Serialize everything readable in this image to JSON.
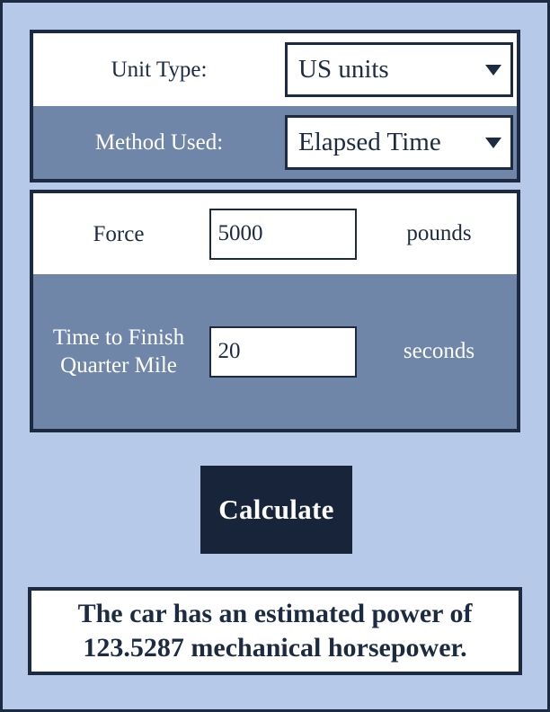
{
  "theme": {
    "page_background": "#b7c9e8",
    "border_dark": "#1c2b42",
    "row_shaded": "#6f86a8",
    "row_light": "#ffffff",
    "button_background": "#17243a",
    "button_text": "#ffffff"
  },
  "form": {
    "settings_rows": [
      {
        "label": "Unit Type:",
        "control": "select",
        "value": "US units",
        "shaded": false,
        "caret": "chevron-down-icon"
      },
      {
        "label": "Method Used:",
        "control": "select",
        "value": "Elapsed Time",
        "shaded": true,
        "caret": "chevron-down-icon"
      }
    ],
    "input_rows": [
      {
        "label": "Force",
        "control": "text",
        "value": "5000",
        "unit": "pounds",
        "shaded": false
      },
      {
        "label": "Time to Finish Quarter Mile",
        "control": "text",
        "value": "20",
        "unit": "seconds",
        "shaded": true
      }
    ]
  },
  "actions": {
    "calculate_label": "Calculate"
  },
  "result": {
    "line1": "The car has an estimated power of",
    "line2": "123.5287 mechanical horsepower.",
    "full_text": "The car has an estimated power of 123.5287 mechanical horsepower.",
    "value": "123.5287",
    "unit": "mechanical horsepower"
  }
}
